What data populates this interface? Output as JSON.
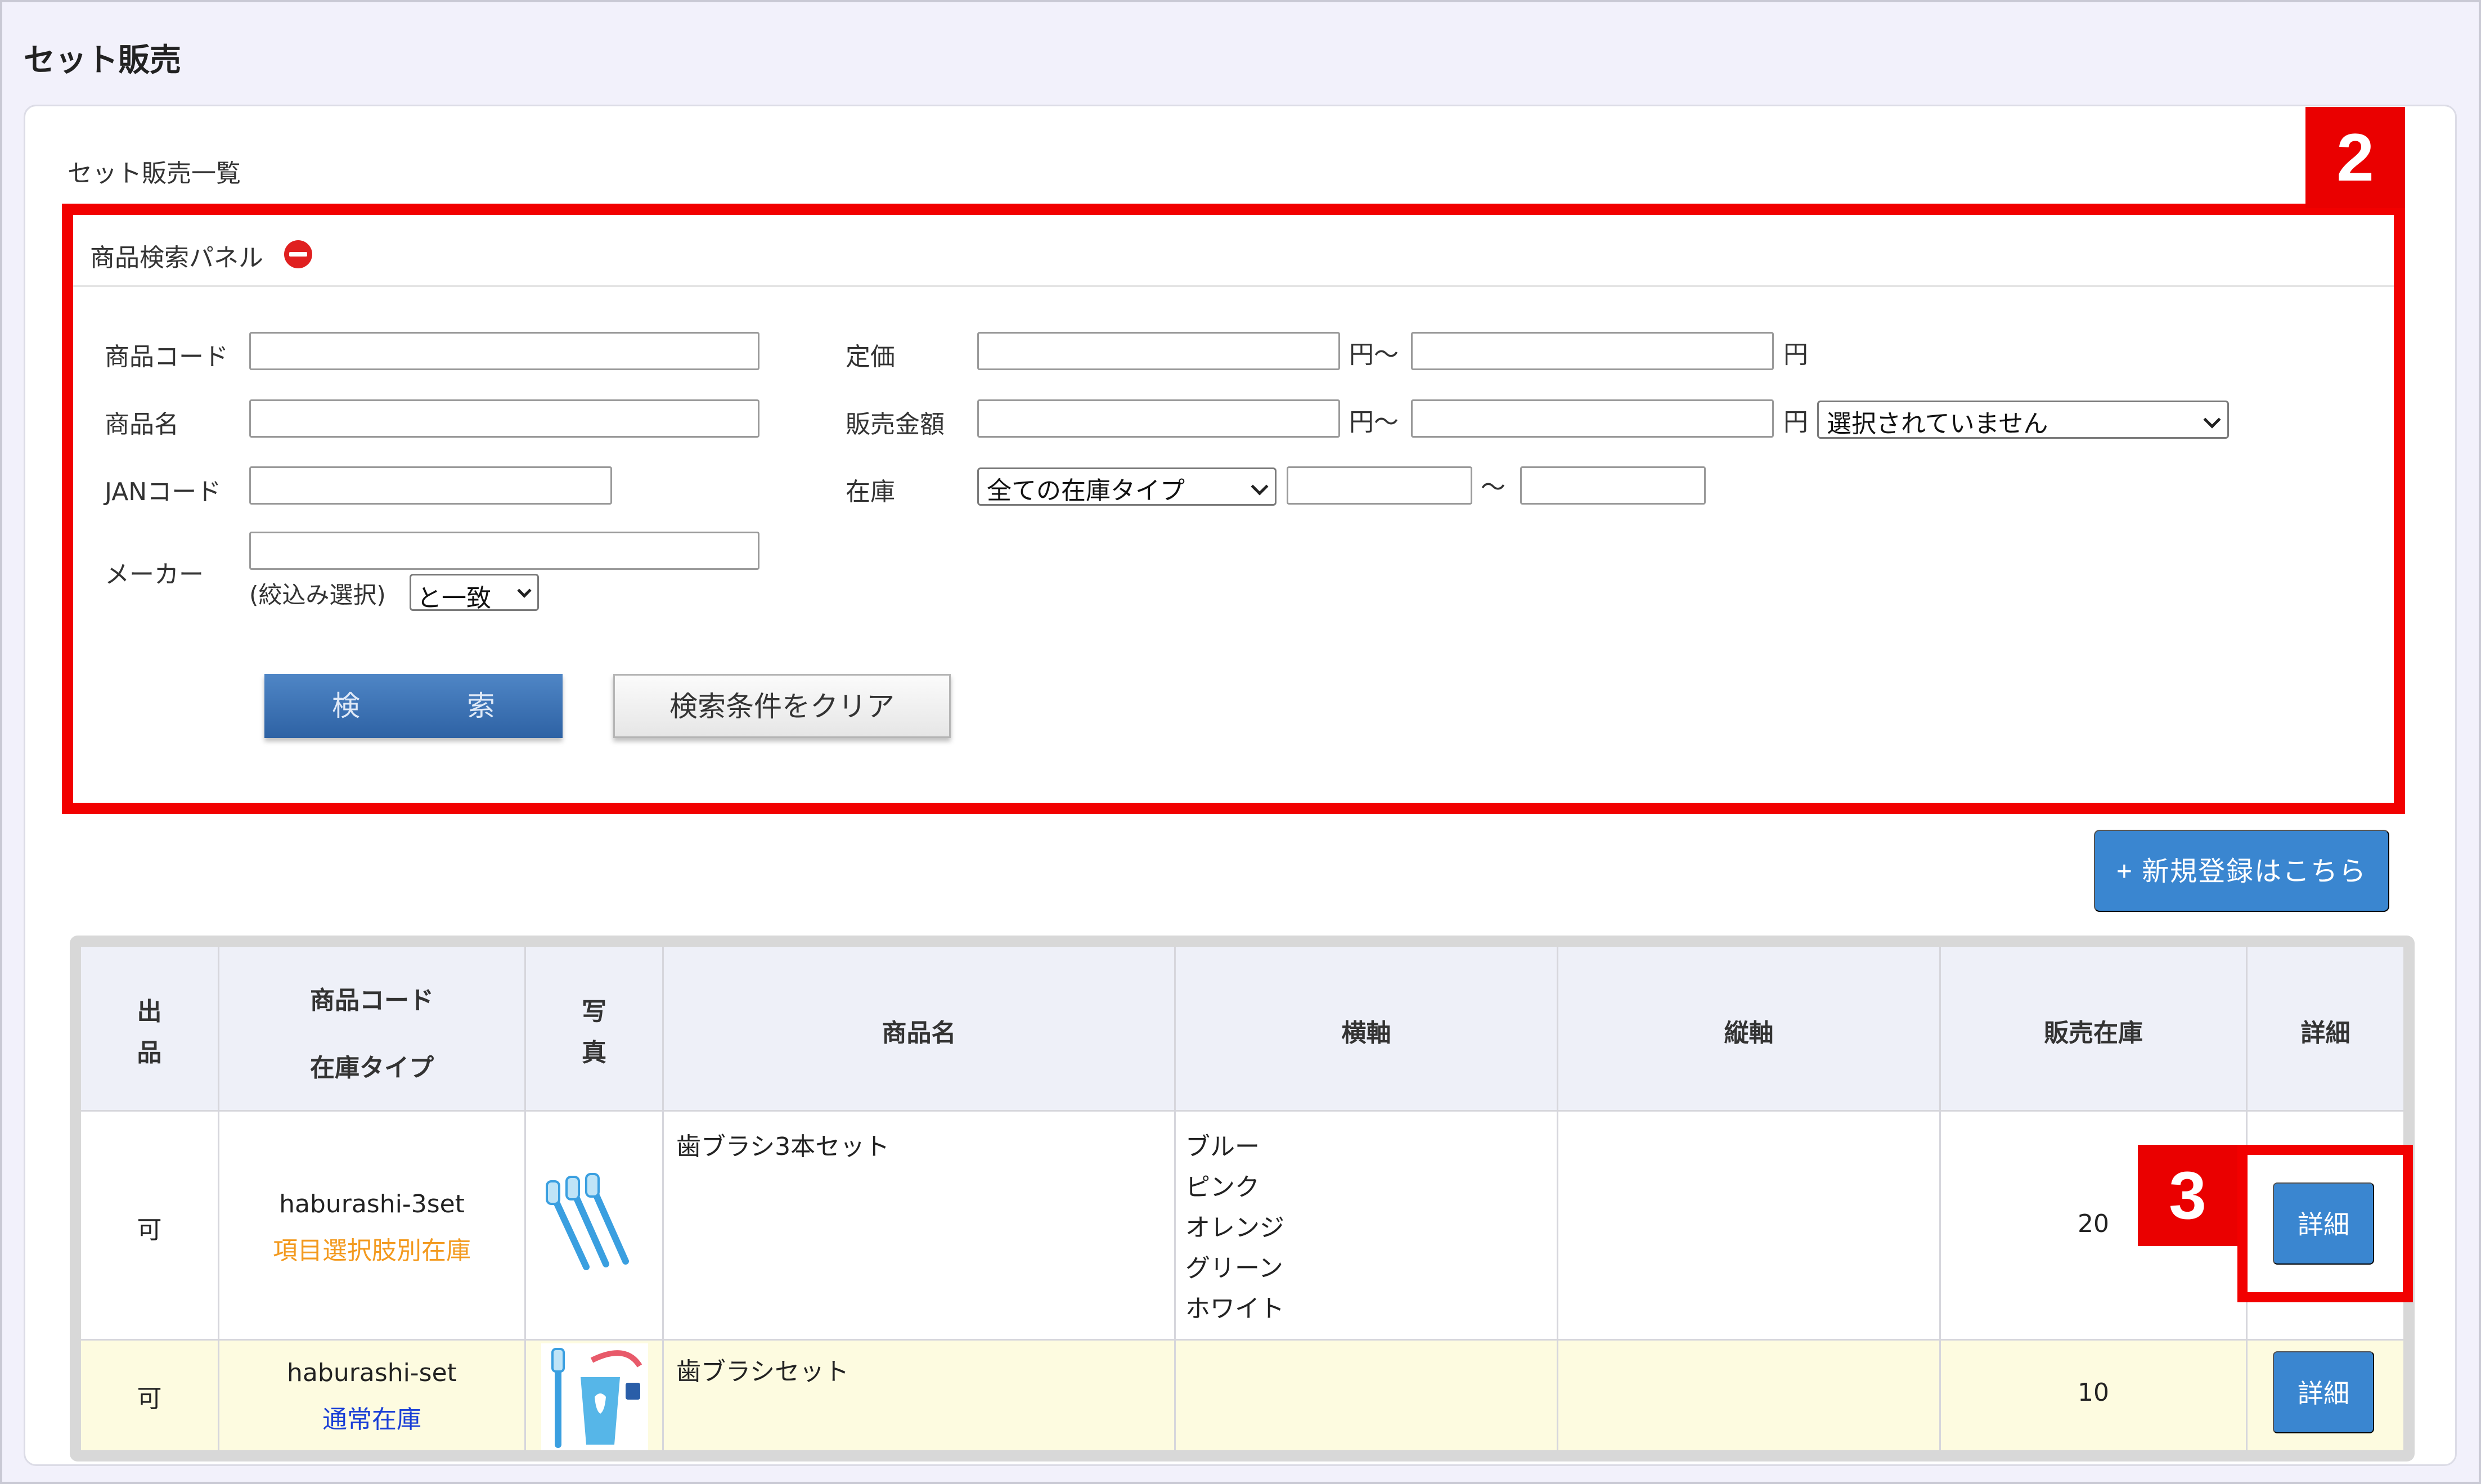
{
  "page": {
    "title": "セット販売"
  },
  "list": {
    "title": "セット販売一覧"
  },
  "search_panel": {
    "title": "商品検索パネル",
    "labels": {
      "product_code": "商品コード",
      "product_name": "商品名",
      "jan_code": "JANコード",
      "maker": "メーカー",
      "list_price": "定価",
      "sale_price": "販売金額",
      "stock": "在庫"
    },
    "unit_yen_range": "円〜",
    "unit_yen": "円",
    "tilde": "〜",
    "maker_hint": "(絞込み選択)",
    "maker_match_select": "と一致",
    "price_type_select": "選択されていません",
    "stock_type_select": "全ての在庫タイプ",
    "search_button": "検　索",
    "clear_button": "検索条件をクリア"
  },
  "annotations": {
    "badge_panel": "2",
    "badge_detail": "3"
  },
  "new_button": "+ 新規登録はこちら",
  "table": {
    "headers": {
      "listing_1": "出",
      "listing_2": "品",
      "code": "商品コード",
      "stock_type": "在庫タイプ",
      "photo_1": "写",
      "photo_2": "真",
      "name": "商品名",
      "horizontal": "横軸",
      "vertical": "縦軸",
      "sale_stock": "販売在庫",
      "detail": "詳細"
    },
    "rows": [
      {
        "listing": "可",
        "code": "haburashi-3set",
        "stock_type": "項目選択肢別在庫",
        "name": "歯ブラシ3本セット",
        "horizontal": [
          "ブルー",
          "ピンク",
          "オレンジ",
          "グリーン",
          "ホワイト"
        ],
        "vertical": "",
        "sale_stock": "20",
        "detail_button": "詳細"
      },
      {
        "listing": "可",
        "code": "haburashi-set",
        "stock_type": "通常在庫",
        "name": "歯ブラシセット",
        "horizontal": [],
        "vertical": "",
        "sale_stock": "10",
        "detail_button": "詳細"
      }
    ]
  },
  "colors": {
    "accent_blue": "#3a86d0",
    "annotation_red": "#f20000",
    "stock_type_orange": "#f39a1f",
    "stock_type_blue": "#1a3fd6",
    "row_highlight": "#fdfbe0"
  }
}
